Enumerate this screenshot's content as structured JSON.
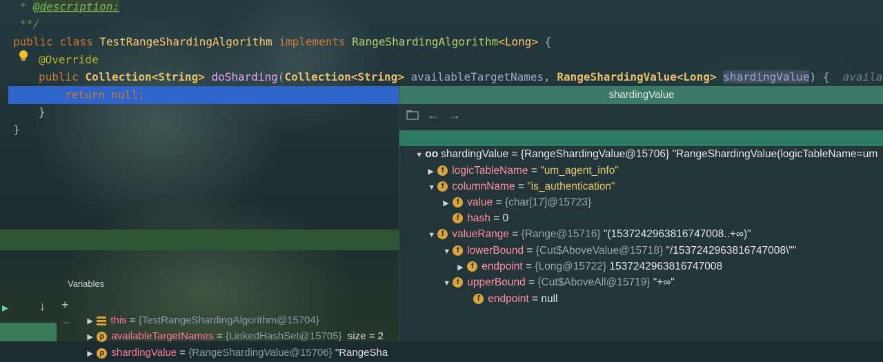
{
  "code": {
    "line1": {
      "star": " * ",
      "tag": "@description:"
    },
    "line2": " **/",
    "line3": {
      "kw1": "public ",
      "kw2": "class ",
      "name": "TestRangeShardingAlgorithm",
      "kw3": " implements ",
      "iface": "RangeShardingAlgorithm",
      "generic": "<Long>",
      "brace": " {"
    },
    "line4": "@Override",
    "line5": {
      "kw": "public ",
      "t1": "Collection<String>",
      "fn": " doSharding",
      "p1": "(",
      "t2": "Collection<String>",
      "n1": " availableTargetNames",
      "comma": ", ",
      "t3": "RangeShardingValue<Long>",
      "sp": " ",
      "n2": "shardingValue",
      "close": ") {",
      "hint": "  availableT"
    },
    "line6": {
      "kw1": "return ",
      "kw2": "null",
      "semi": ";"
    },
    "line7": "}",
    "line8": "}"
  },
  "variables": {
    "title": "Variables",
    "rows": [
      {
        "name": "this",
        "eq": " = ",
        "type": "{TestRangeShardingAlgorithm@15704}",
        "extra": ""
      },
      {
        "badge": "p",
        "name": "availableTargetNames",
        "eq": " = ",
        "type": "{LinkedHashSet@15705}",
        "extra": "  size = 2"
      },
      {
        "badge": "p",
        "name": "shardingValue",
        "eq": " = ",
        "type": "{RangeShardingValue@15706}",
        "extra": " \"RangeSha"
      }
    ]
  },
  "popup": {
    "title": "shardingValue",
    "rows": [
      {
        "name": "shardingValue",
        "eq": " = ",
        "type": "{RangeShardingValue@15706}",
        "val": " \"RangeShardingValue(logicTableName=um"
      },
      {
        "badge": "f",
        "name": "logicTableName",
        "eq": " = ",
        "type": "",
        "val": "\"um_agent_info\""
      },
      {
        "badge": "f",
        "name": "columnName",
        "eq": " = ",
        "type": "",
        "val": "\"is_authentication\""
      },
      {
        "badge": "f",
        "name": "value",
        "eq": " = ",
        "type": "{char[17]@15723}",
        "val": ""
      },
      {
        "badge": "f",
        "name": "hash",
        "eq": " = ",
        "type": "",
        "val": "0"
      },
      {
        "badge": "f",
        "name": "valueRange",
        "eq": " = ",
        "type": "{Range@15716}",
        "val": " \"(1537242963816747008..+∞)\""
      },
      {
        "badge": "f",
        "name": "lowerBound",
        "eq": " = ",
        "type": "{Cut$AboveValue@15718}",
        "val": " \"/1537242963816747008\\\"\""
      },
      {
        "badge": "f",
        "name": "endpoint",
        "eq": " = ",
        "type": "{Long@15722}",
        "val": " 1537242963816747008"
      },
      {
        "badge": "f",
        "name": "upperBound",
        "eq": " = ",
        "type": "{Cut$AboveAll@15719}",
        "val": " \"+∞\""
      },
      {
        "badge": "f",
        "name": "endpoint",
        "eq": " = ",
        "type": "",
        "val": "null"
      }
    ]
  },
  "icons": {
    "expand": "▶",
    "collapse": "▼",
    "back": "←",
    "forward": "→",
    "plus": "+",
    "minus": "−",
    "down": "↓",
    "glasses": "oo"
  }
}
